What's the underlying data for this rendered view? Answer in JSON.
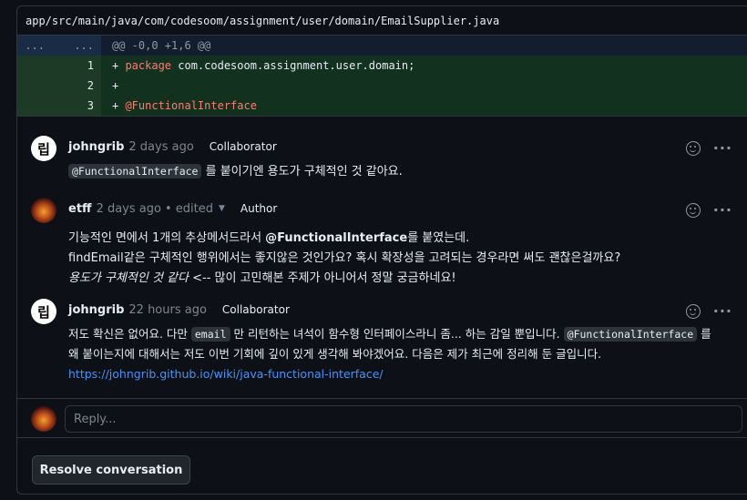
{
  "file": {
    "path": "app/src/main/java/com/codesoom/assignment/user/domain/EmailSupplier.java"
  },
  "diff": {
    "hunk": {
      "left": "...",
      "right": "...",
      "text": "@@ -0,0 +1,6 @@"
    },
    "lines": [
      {
        "num": "1",
        "prefix": "+ ",
        "keyword": "package",
        "rest": " com.codesoom.assignment.user.domain;"
      },
      {
        "num": "2",
        "prefix": "+",
        "keyword": "",
        "rest": ""
      },
      {
        "num": "3",
        "prefix": "+ ",
        "keyword": "@FunctionalInterface",
        "rest": ""
      }
    ]
  },
  "comments": [
    {
      "author": "johngrib",
      "when": "2 days ago",
      "role": "Collaborator",
      "chip": "@FunctionalInterface",
      "text": " 를 붙이기엔 용도가 구체적인 것 같아요."
    },
    {
      "author": "etff",
      "when": "2 days ago",
      "edited": "• edited",
      "role": "Author",
      "line1_a": "기능적인 면에서 1개의 추상메서드라서 ",
      "line1_b": "@FunctionalInterface",
      "line1_c": "를 붙였는데.",
      "line2": "findEmail같은 구체적인 행위에서는 좋지않은 것인가요? 혹시 확장성을 고려되는 경우라면 써도 괜찮은걸까요?",
      "line3_a": "용도가 구체적인 것 같다",
      "line3_b": " <-- 많이 고민해본 주제가 아니어서 정말 궁금하네요!"
    },
    {
      "author": "johngrib",
      "when": "22 hours ago",
      "role": "Collaborator",
      "line1_a": "저도 확신은 없어요. 다만 ",
      "chip1": "email",
      "line1_b": " 만 리턴하는 녀석이 함수형 인터페이스라니 좀... 하는 감일 뿐입니다. ",
      "chip2": "@FunctionalInterface",
      "line1_c": " 를",
      "line2": "왜 붙이는지에 대해서는 저도 이번 기회에 깊이 있게 생각해 봐야겠어요. 다음은 제가 최근에 정리해 둔 글입니다.",
      "link": "https://johngrib.github.io/wiki/java-functional-interface/"
    }
  ],
  "avatar_letter": "립",
  "reply": {
    "placeholder": "Reply..."
  },
  "resolve_label": "Resolve conversation"
}
